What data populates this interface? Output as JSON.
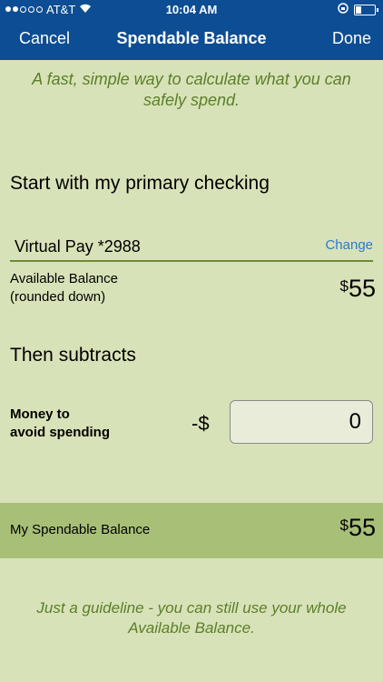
{
  "status": {
    "carrier": "AT&T",
    "time": "10:04 AM"
  },
  "nav": {
    "cancel_label": "Cancel",
    "title": "Spendable Balance",
    "done_label": "Done"
  },
  "intro_text": "A fast, simple way to calculate what you can safely spend.",
  "start_section": {
    "title": "Start with my primary checking",
    "account_name": "Virtual Pay *2988",
    "change_label": "Change",
    "available_label_line1": "Available Balance",
    "available_label_line2": "(rounded down)",
    "currency": "$",
    "available_amount": "55"
  },
  "subtract_section": {
    "title": "Then subtracts",
    "money_label_line1": "Money to",
    "money_label_line2": "avoid spending",
    "prefix": "-$",
    "money_value": "0"
  },
  "result": {
    "label": "My Spendable Balance",
    "currency": "$",
    "amount": "55"
  },
  "footer_text": "Just a guideline - you can still use your whole Available Balance.",
  "colors": {
    "nav_bg": "#0d4d93",
    "page_bg": "#d8e2b8",
    "accent_green": "#5b7f2a",
    "result_bar": "#a8bf78",
    "link_blue": "#2a7bd6"
  }
}
